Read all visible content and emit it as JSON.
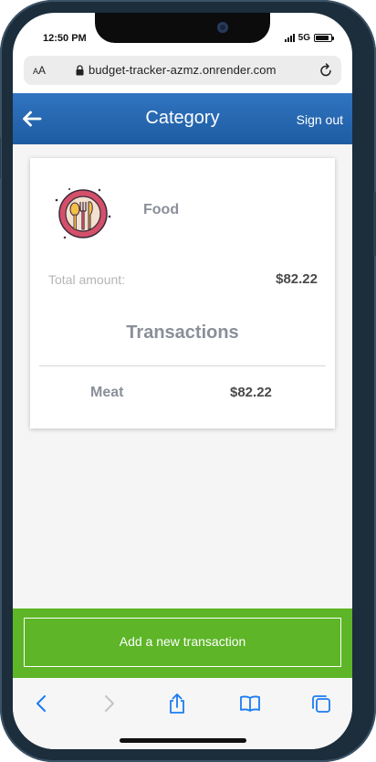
{
  "status_bar": {
    "time": "12:50 PM",
    "network": "5G",
    "battery_level": 0.85
  },
  "browser": {
    "text_size_label": "AA",
    "url": "budget-tracker-azmz.onrender.com"
  },
  "header": {
    "title": "Category",
    "sign_out_label": "Sign out"
  },
  "category": {
    "name": "Food",
    "icon": "food-plate-icon",
    "total_label": "Total amount:",
    "total_value": "$82.22"
  },
  "transactions": {
    "heading": "Transactions",
    "items": [
      {
        "name": "Meat",
        "amount": "$82.22"
      }
    ]
  },
  "actions": {
    "add_label": "Add a new transaction"
  },
  "toolbar": {
    "icons": [
      "back-icon",
      "forward-icon",
      "share-icon",
      "bookmarks-icon",
      "tabs-icon"
    ]
  },
  "colors": {
    "header_blue": "#2569b3",
    "add_green": "#5db527",
    "text_gray": "#8a8f99",
    "accent_blue": "#1a7cf2"
  }
}
